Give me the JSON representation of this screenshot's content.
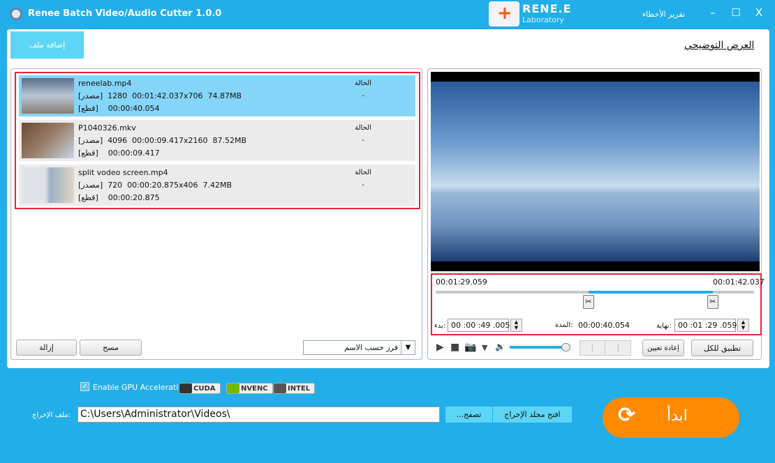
{
  "titlebar": {
    "title": "Renee Batch Video/Audio Cutter 1.0.0",
    "logo_text": "RENE.E",
    "logo_sub": "Laboratory",
    "error_report": "تقرير الأخطاء",
    "minimize": "–",
    "maximize": "☐",
    "close": "X"
  },
  "toolbar": {
    "add_file": "إضافة ملف",
    "demo_link": "العرض التوضيحي"
  },
  "files": [
    {
      "name": "reneelab.mp4",
      "source_label": "[مصدر]",
      "source_info": "00:01:42.037  1280x706  74.87MB",
      "cut_label": "[قطع]",
      "cut_duration": "00:00:40.054",
      "status_label": "الحالة",
      "status": "-",
      "selected": true
    },
    {
      "name": "P1040326.mkv",
      "source_label": "[مصدر]",
      "source_info": "00:00:09.417  4096x2160  87.52MB",
      "cut_label": "[قطع]",
      "cut_duration": "00:00:09.417",
      "status_label": "الحالة",
      "status": "-",
      "selected": false
    },
    {
      "name": "split vodeo screen.mp4",
      "source_label": "[مصدر]",
      "source_info": "00:00:20.875  720x406  7.42MB",
      "cut_label": "[قطع]",
      "cut_duration": "00:00:20.875",
      "status_label": "الحالة",
      "status": "-",
      "selected": false
    }
  ],
  "list_actions": {
    "remove": "إزالة",
    "clear": "مسح",
    "sort_selected": "فرز حسب الاسم"
  },
  "trim": {
    "left_time": "00:01:29.059",
    "right_time": "00:01:42.037",
    "range_start_fraction": 0.48,
    "range_end_fraction": 0.87,
    "start_label": "بدء:",
    "start_value": "00 :00 :49 .005",
    "duration_label": "المدة:",
    "duration_value": "00:00:40.054",
    "end_label": "نهاية:",
    "end_value": "00 :01 :29 .059"
  },
  "player": {
    "volume_fraction": 1.0,
    "reset": "إعادة تعيين",
    "apply_all": "تطبيق للكل",
    "mark_in": "[",
    "mark_out": "]"
  },
  "gpu": {
    "enable_label": "Enable GPU Acceleration",
    "checked": true,
    "badges": [
      "CUDA",
      "NVENC",
      "INTEL"
    ]
  },
  "output": {
    "label": "ملف الإخراج:",
    "path": "C:\\Users\\Administrator\\Videos\\",
    "browse": "...تصفح",
    "open_folder": "افتح مجلد الإخراج"
  },
  "start": {
    "label": "ابدأ"
  },
  "colors": {
    "brand": "#22aee8",
    "accent": "#ff8a00",
    "selected_row": "#85d5f9",
    "highlight": "#e32636"
  }
}
